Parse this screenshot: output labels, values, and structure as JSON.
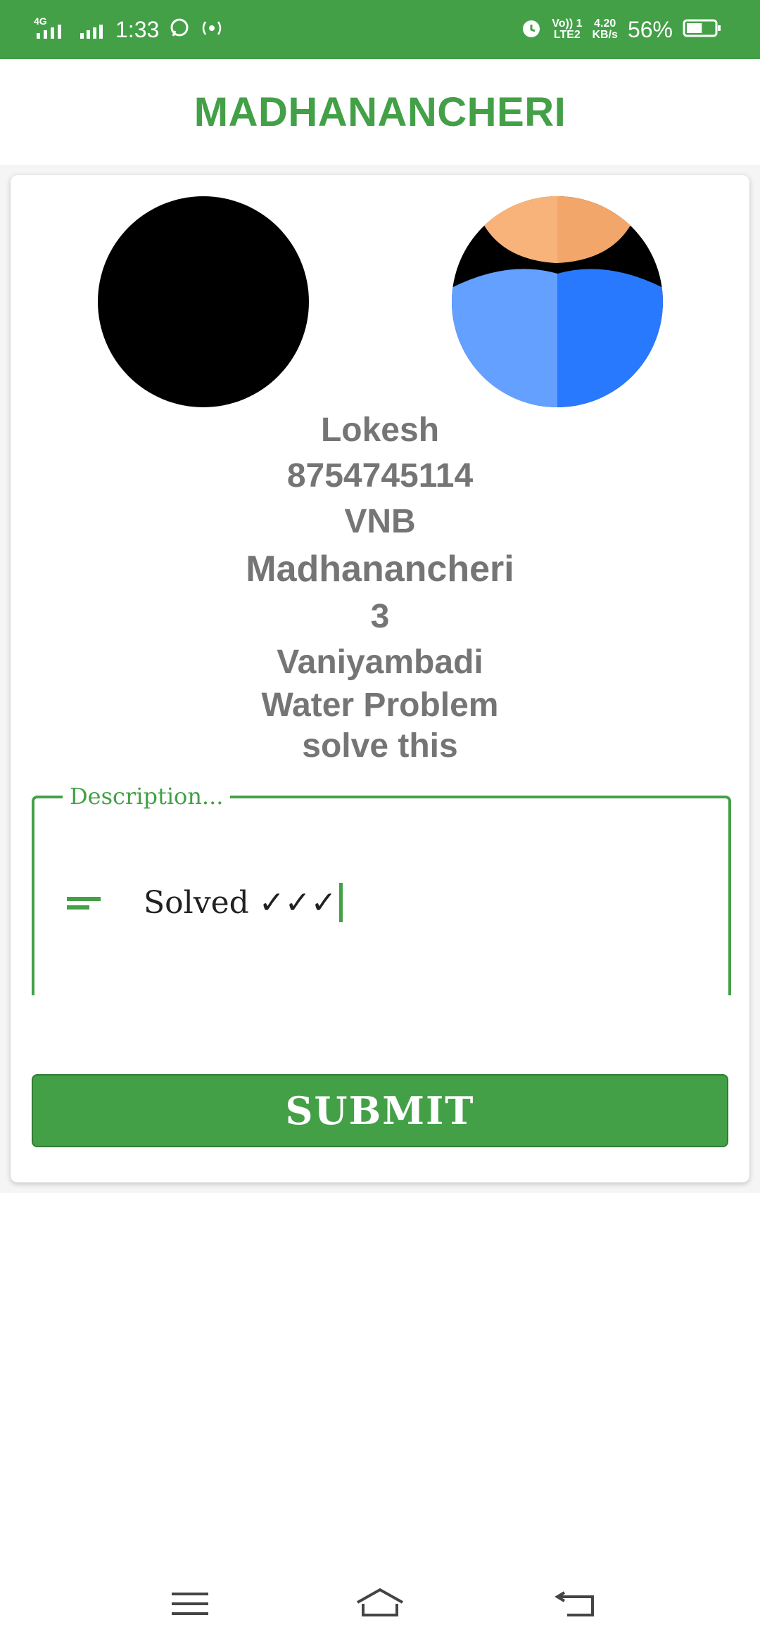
{
  "status_bar": {
    "network_type": "4G",
    "time": "1:33",
    "volte_label": "Vo)) 1",
    "lte_label": "LTE2",
    "speed_value": "4.20",
    "speed_unit": "KB/s",
    "battery": "56%",
    "battery_level": 0.56,
    "icons": [
      "signal-icon",
      "signal-icon",
      "whatsapp-icon",
      "hotspot-icon",
      "alarm-icon",
      "battery-icon"
    ]
  },
  "app_bar": {
    "title": "MADHANANCHERI"
  },
  "profile": {
    "name": "Lokesh",
    "phone": "8754745114",
    "code": "VNB",
    "area": "Madhanancheri",
    "ward": "3",
    "city": "Vaniyambadi",
    "issue": "Water Problem",
    "note": "solve this"
  },
  "form": {
    "description_label": "Description...",
    "description_value": "Solved ✓✓✓",
    "submit_label": "SUBMIT"
  },
  "colors": {
    "primary": "#43a047",
    "text_gray": "#757575"
  }
}
